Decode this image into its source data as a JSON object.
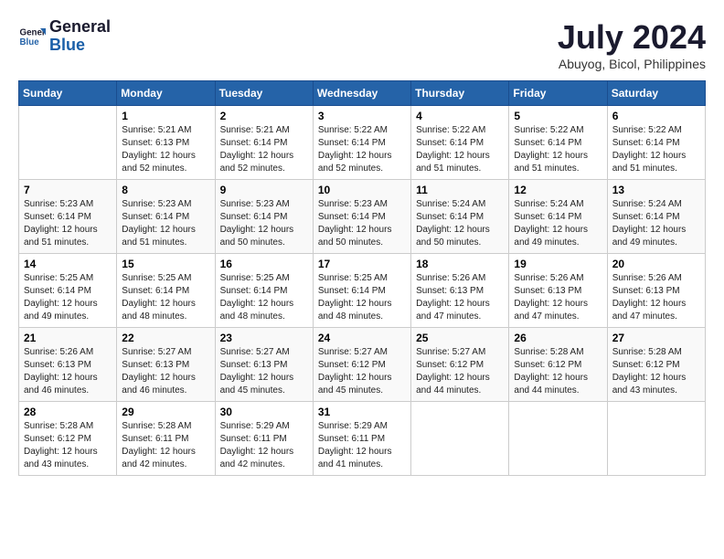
{
  "logo": {
    "line1": "General",
    "line2": "Blue"
  },
  "title": "July 2024",
  "location": "Abuyog, Bicol, Philippines",
  "weekdays": [
    "Sunday",
    "Monday",
    "Tuesday",
    "Wednesday",
    "Thursday",
    "Friday",
    "Saturday"
  ],
  "weeks": [
    [
      {
        "day": "",
        "sunrise": "",
        "sunset": "",
        "daylight": ""
      },
      {
        "day": "1",
        "sunrise": "5:21 AM",
        "sunset": "6:13 PM",
        "daylight": "12 hours and 52 minutes."
      },
      {
        "day": "2",
        "sunrise": "5:21 AM",
        "sunset": "6:14 PM",
        "daylight": "12 hours and 52 minutes."
      },
      {
        "day": "3",
        "sunrise": "5:22 AM",
        "sunset": "6:14 PM",
        "daylight": "12 hours and 52 minutes."
      },
      {
        "day": "4",
        "sunrise": "5:22 AM",
        "sunset": "6:14 PM",
        "daylight": "12 hours and 51 minutes."
      },
      {
        "day": "5",
        "sunrise": "5:22 AM",
        "sunset": "6:14 PM",
        "daylight": "12 hours and 51 minutes."
      },
      {
        "day": "6",
        "sunrise": "5:22 AM",
        "sunset": "6:14 PM",
        "daylight": "12 hours and 51 minutes."
      }
    ],
    [
      {
        "day": "7",
        "sunrise": "5:23 AM",
        "sunset": "6:14 PM",
        "daylight": "12 hours and 51 minutes."
      },
      {
        "day": "8",
        "sunrise": "5:23 AM",
        "sunset": "6:14 PM",
        "daylight": "12 hours and 51 minutes."
      },
      {
        "day": "9",
        "sunrise": "5:23 AM",
        "sunset": "6:14 PM",
        "daylight": "12 hours and 50 minutes."
      },
      {
        "day": "10",
        "sunrise": "5:23 AM",
        "sunset": "6:14 PM",
        "daylight": "12 hours and 50 minutes."
      },
      {
        "day": "11",
        "sunrise": "5:24 AM",
        "sunset": "6:14 PM",
        "daylight": "12 hours and 50 minutes."
      },
      {
        "day": "12",
        "sunrise": "5:24 AM",
        "sunset": "6:14 PM",
        "daylight": "12 hours and 49 minutes."
      },
      {
        "day": "13",
        "sunrise": "5:24 AM",
        "sunset": "6:14 PM",
        "daylight": "12 hours and 49 minutes."
      }
    ],
    [
      {
        "day": "14",
        "sunrise": "5:25 AM",
        "sunset": "6:14 PM",
        "daylight": "12 hours and 49 minutes."
      },
      {
        "day": "15",
        "sunrise": "5:25 AM",
        "sunset": "6:14 PM",
        "daylight": "12 hours and 48 minutes."
      },
      {
        "day": "16",
        "sunrise": "5:25 AM",
        "sunset": "6:14 PM",
        "daylight": "12 hours and 48 minutes."
      },
      {
        "day": "17",
        "sunrise": "5:25 AM",
        "sunset": "6:14 PM",
        "daylight": "12 hours and 48 minutes."
      },
      {
        "day": "18",
        "sunrise": "5:26 AM",
        "sunset": "6:13 PM",
        "daylight": "12 hours and 47 minutes."
      },
      {
        "day": "19",
        "sunrise": "5:26 AM",
        "sunset": "6:13 PM",
        "daylight": "12 hours and 47 minutes."
      },
      {
        "day": "20",
        "sunrise": "5:26 AM",
        "sunset": "6:13 PM",
        "daylight": "12 hours and 47 minutes."
      }
    ],
    [
      {
        "day": "21",
        "sunrise": "5:26 AM",
        "sunset": "6:13 PM",
        "daylight": "12 hours and 46 minutes."
      },
      {
        "day": "22",
        "sunrise": "5:27 AM",
        "sunset": "6:13 PM",
        "daylight": "12 hours and 46 minutes."
      },
      {
        "day": "23",
        "sunrise": "5:27 AM",
        "sunset": "6:13 PM",
        "daylight": "12 hours and 45 minutes."
      },
      {
        "day": "24",
        "sunrise": "5:27 AM",
        "sunset": "6:12 PM",
        "daylight": "12 hours and 45 minutes."
      },
      {
        "day": "25",
        "sunrise": "5:27 AM",
        "sunset": "6:12 PM",
        "daylight": "12 hours and 44 minutes."
      },
      {
        "day": "26",
        "sunrise": "5:28 AM",
        "sunset": "6:12 PM",
        "daylight": "12 hours and 44 minutes."
      },
      {
        "day": "27",
        "sunrise": "5:28 AM",
        "sunset": "6:12 PM",
        "daylight": "12 hours and 43 minutes."
      }
    ],
    [
      {
        "day": "28",
        "sunrise": "5:28 AM",
        "sunset": "6:12 PM",
        "daylight": "12 hours and 43 minutes."
      },
      {
        "day": "29",
        "sunrise": "5:28 AM",
        "sunset": "6:11 PM",
        "daylight": "12 hours and 42 minutes."
      },
      {
        "day": "30",
        "sunrise": "5:29 AM",
        "sunset": "6:11 PM",
        "daylight": "12 hours and 42 minutes."
      },
      {
        "day": "31",
        "sunrise": "5:29 AM",
        "sunset": "6:11 PM",
        "daylight": "12 hours and 41 minutes."
      },
      {
        "day": "",
        "sunrise": "",
        "sunset": "",
        "daylight": ""
      },
      {
        "day": "",
        "sunrise": "",
        "sunset": "",
        "daylight": ""
      },
      {
        "day": "",
        "sunrise": "",
        "sunset": "",
        "daylight": ""
      }
    ]
  ]
}
